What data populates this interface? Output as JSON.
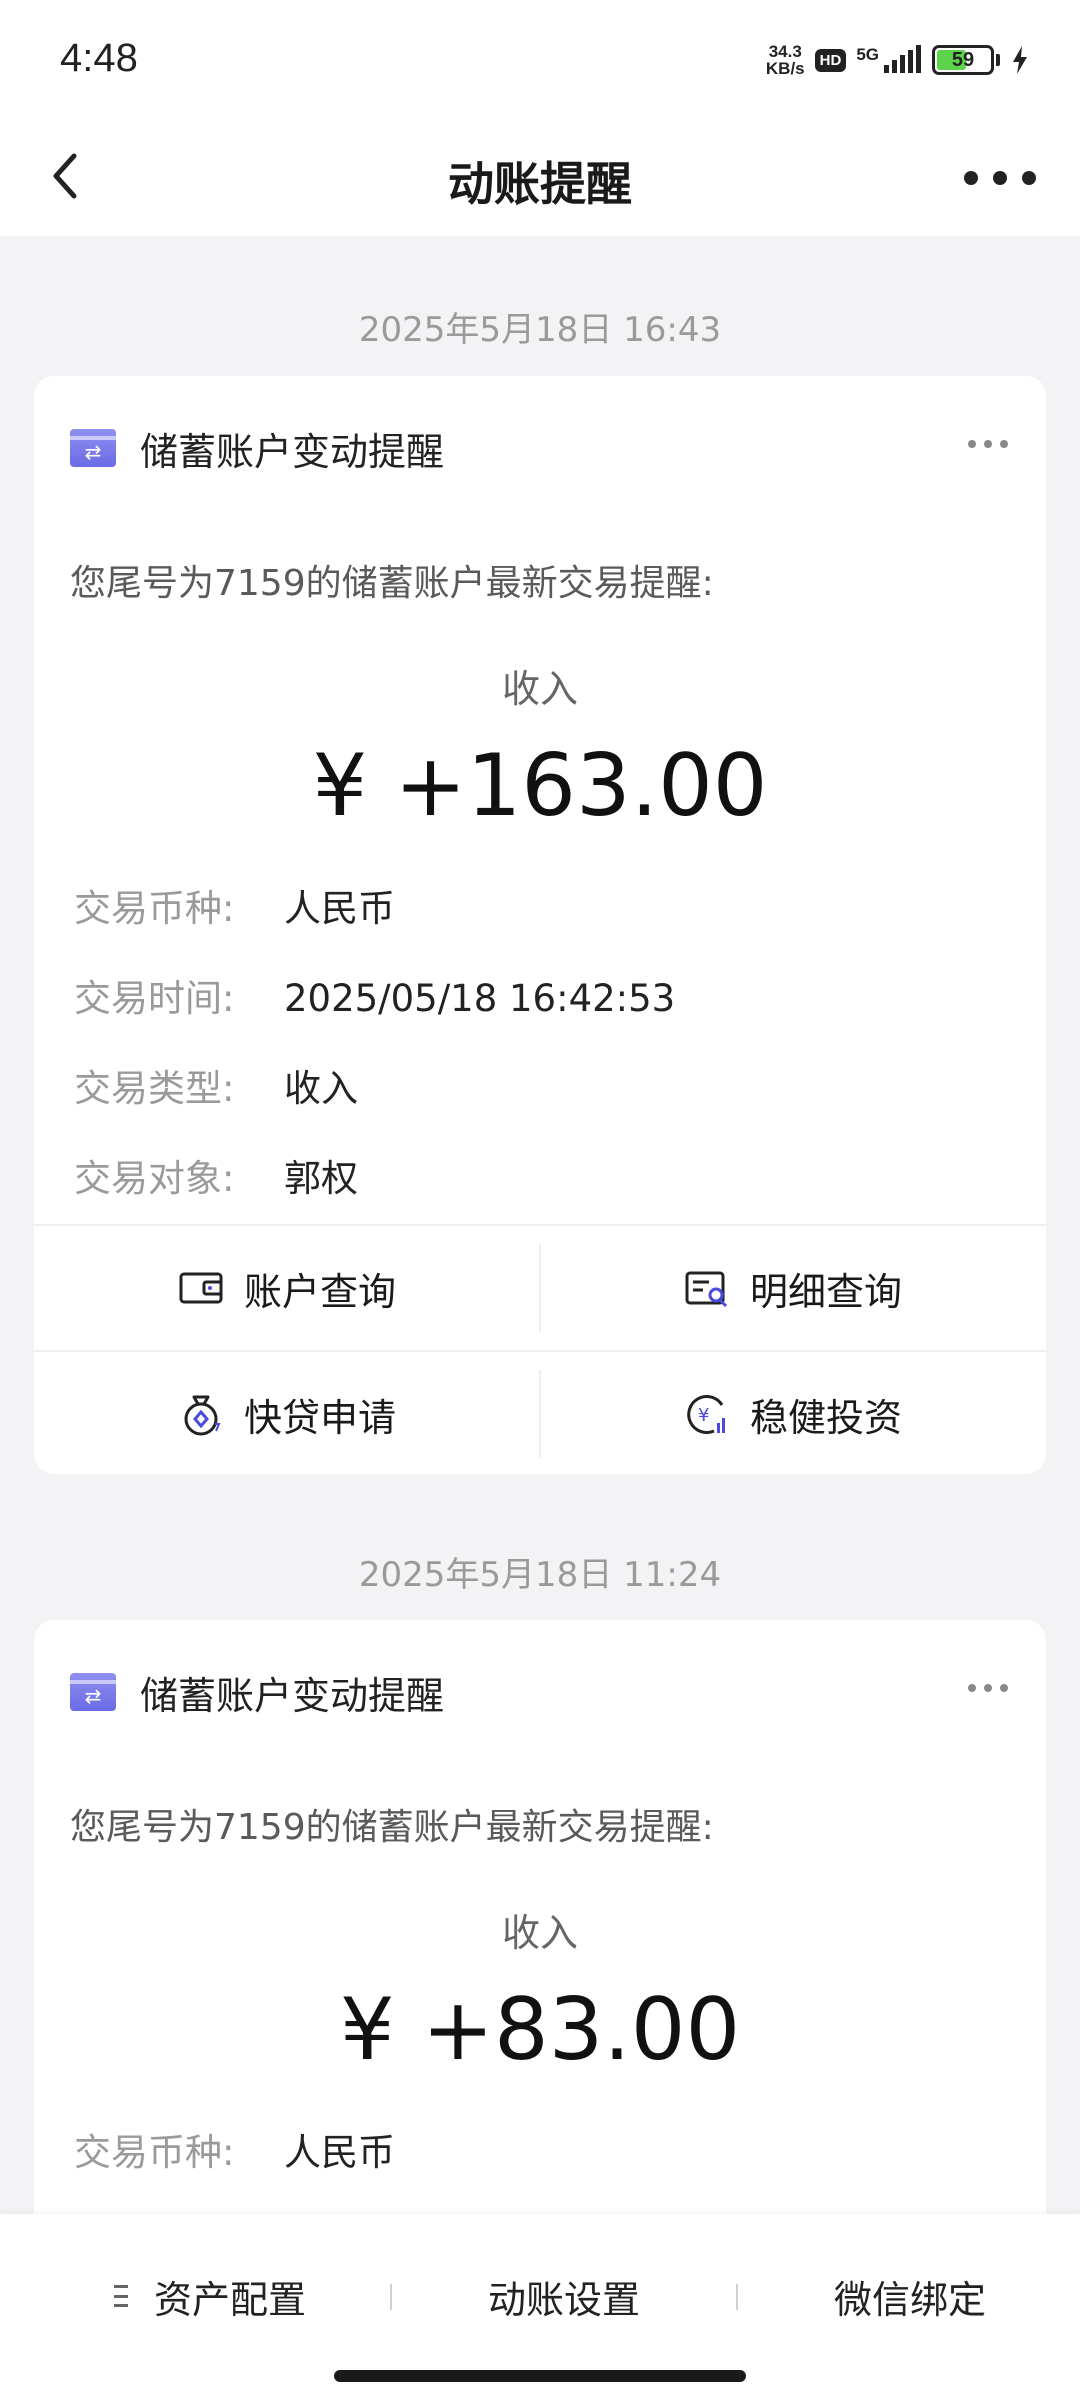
{
  "status_bar": {
    "time": "4:48",
    "net_speed_value": "34.3",
    "net_speed_unit": "KB/s",
    "hd": "HD",
    "signal": "5G",
    "battery": "59",
    "battery_level_percent": 59,
    "battery_color": "#5bd449"
  },
  "nav": {
    "title": "动账提醒",
    "back_icon": "chevron-left-icon",
    "more_icon": "more-dots-icon"
  },
  "messages": [
    {
      "date": "2025年5月18日 16:43",
      "card_title": "储蓄账户变动提醒",
      "description": "您尾号为7159的储蓄账户最新交易提醒:",
      "type_label": "收入",
      "amount": "¥ +163.00",
      "details": [
        {
          "label": "交易币种:",
          "value": "人民币"
        },
        {
          "label": "交易时间:",
          "value": "2025/05/18 16:42:53"
        },
        {
          "label": "交易类型:",
          "value": "收入"
        },
        {
          "label": "交易对象:",
          "value": "郭权"
        }
      ],
      "actions": [
        {
          "label": "账户查询",
          "icon": "wallet-icon"
        },
        {
          "label": "明细查询",
          "icon": "statement-search-icon"
        },
        {
          "label": "快贷申请",
          "icon": "loan-bag-icon"
        },
        {
          "label": "稳健投资",
          "icon": "investment-yuan-icon"
        }
      ]
    },
    {
      "date": "2025年5月18日 11:24",
      "card_title": "储蓄账户变动提醒",
      "description": "您尾号为7159的储蓄账户最新交易提醒:",
      "type_label": "收入",
      "amount": "¥ +83.00",
      "details": [
        {
          "label": "交易币种:",
          "value": "人民币"
        }
      ]
    }
  ],
  "bottom_bar": {
    "items": [
      {
        "label": "资产配置"
      },
      {
        "label": "动账设置"
      },
      {
        "label": "微信绑定"
      }
    ]
  },
  "colors": {
    "accent_icon": "#7a7aee",
    "page_background": "#f3f3f5"
  }
}
